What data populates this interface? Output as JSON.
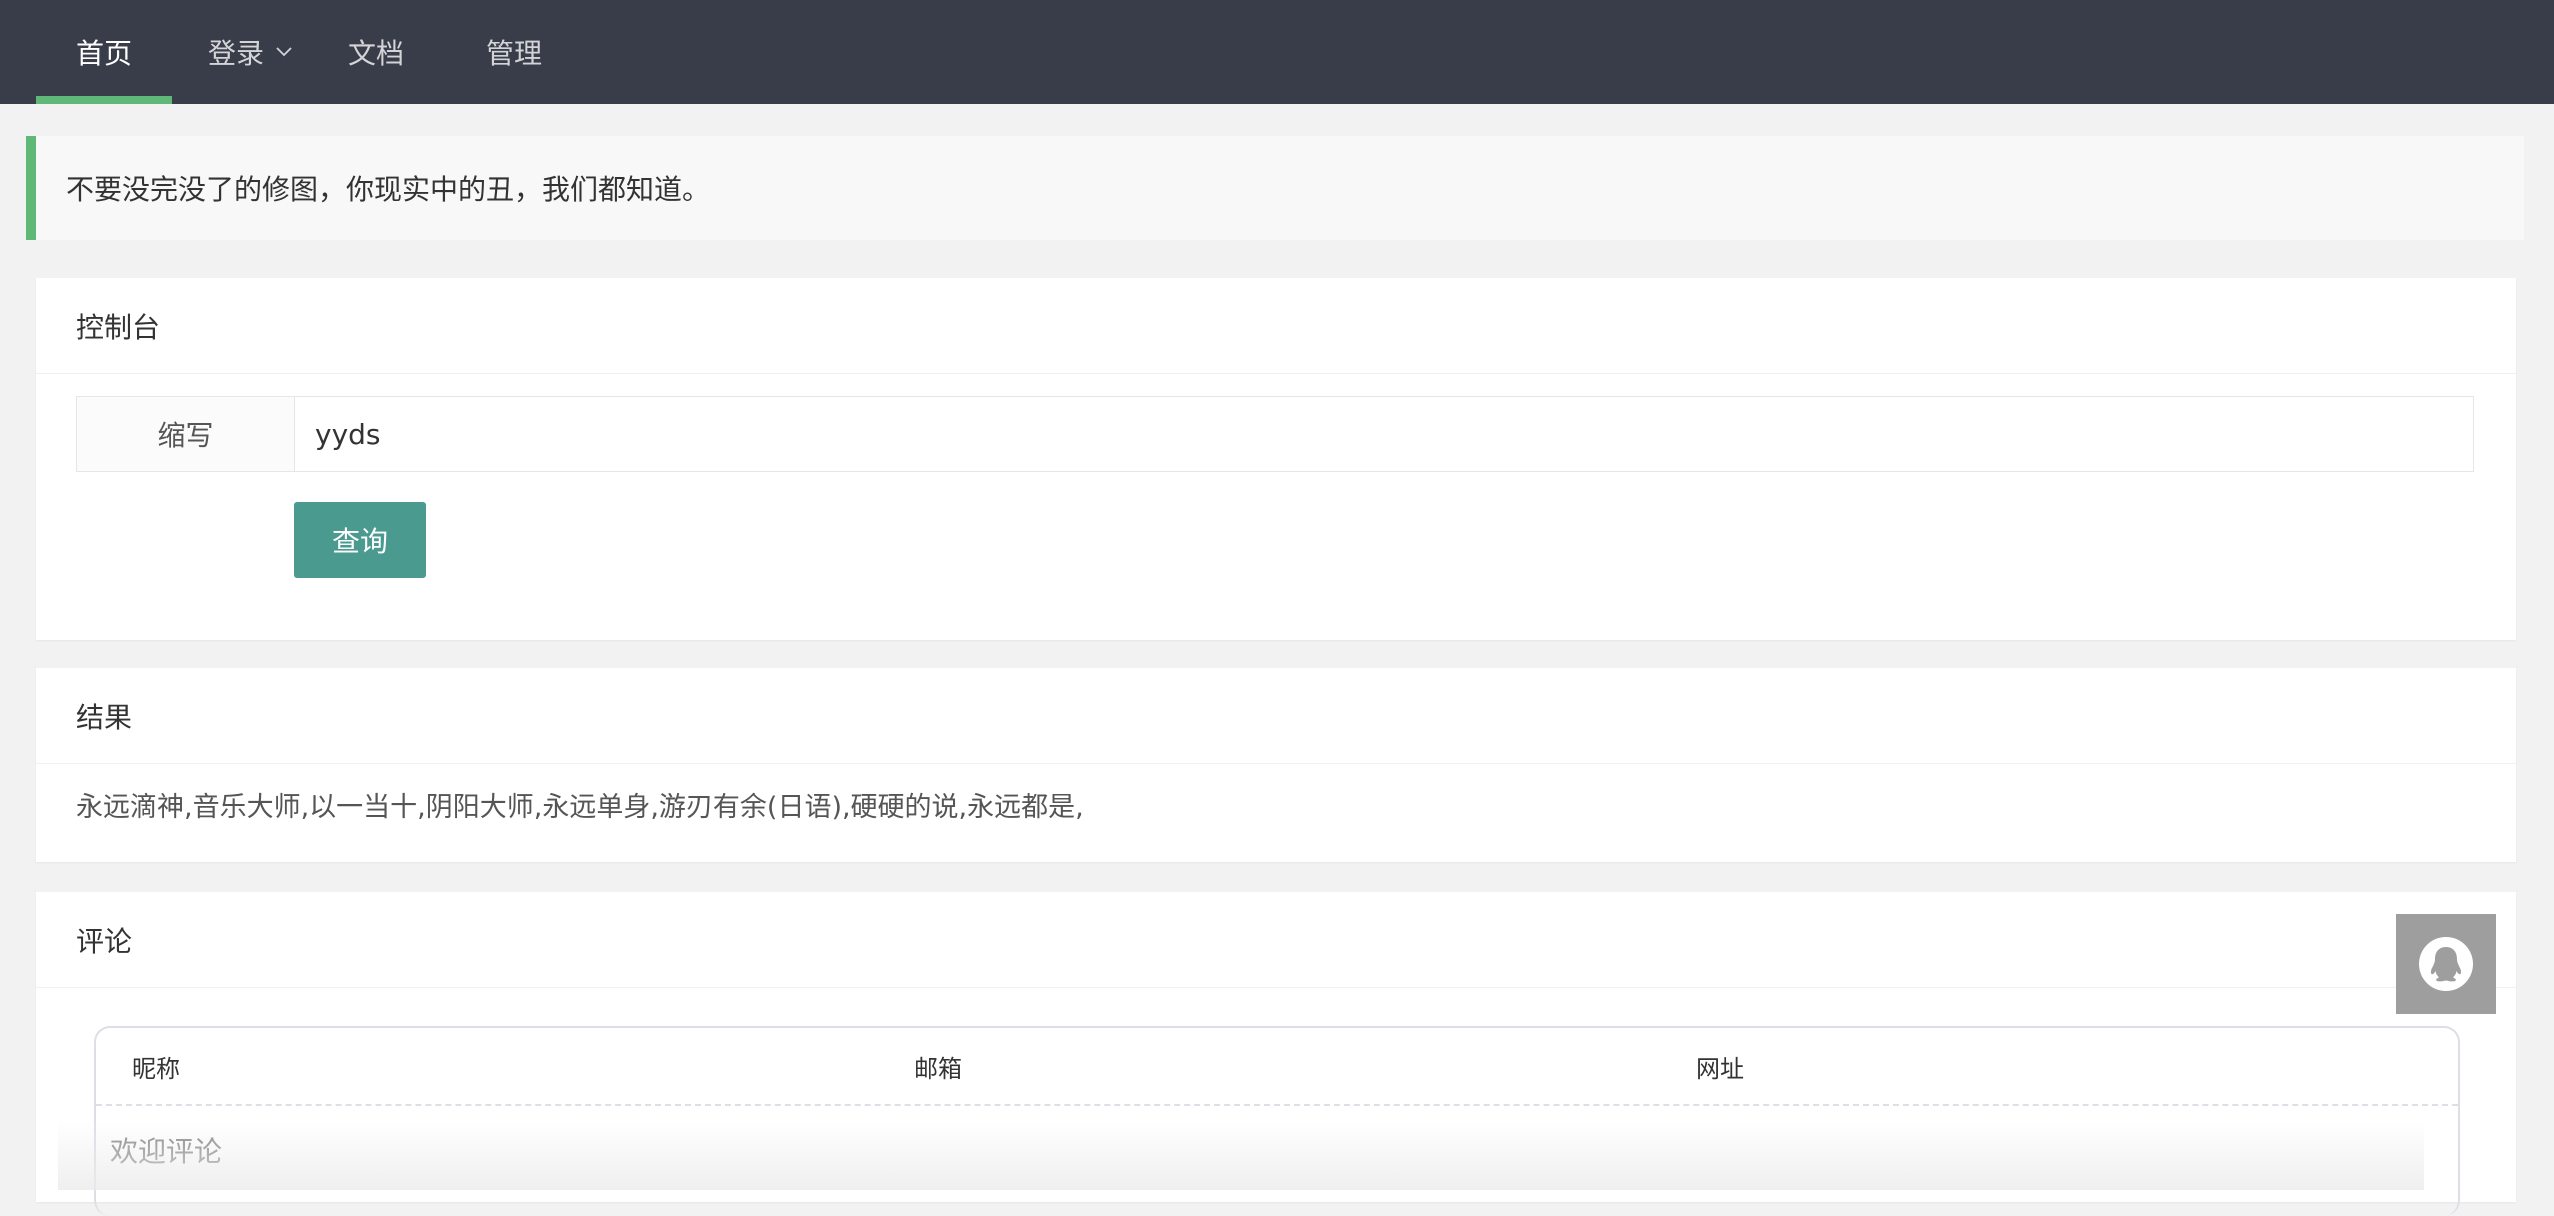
{
  "nav": {
    "home": "首页",
    "login": "登录",
    "docs": "文档",
    "admin": "管理"
  },
  "quote": "不要没完没了的修图，你现实中的丑，我们都知道。",
  "console": {
    "title": "控制台",
    "label": "缩写",
    "input_value": "yyds",
    "query_label": "查询"
  },
  "result": {
    "title": "结果",
    "text": "永远滴神,音乐大师,以一当十,阴阳大师,永远单身,游刃有余(日语),硬硬的说,永远都是,"
  },
  "comment": {
    "title": "评论",
    "nick_label": "昵称",
    "email_label": "邮箱",
    "url_label": "网址",
    "placeholder": "欢迎评论"
  },
  "colors": {
    "nav_bg": "#393d49",
    "accent": "#5fb878",
    "button": "#4a9a8f"
  }
}
